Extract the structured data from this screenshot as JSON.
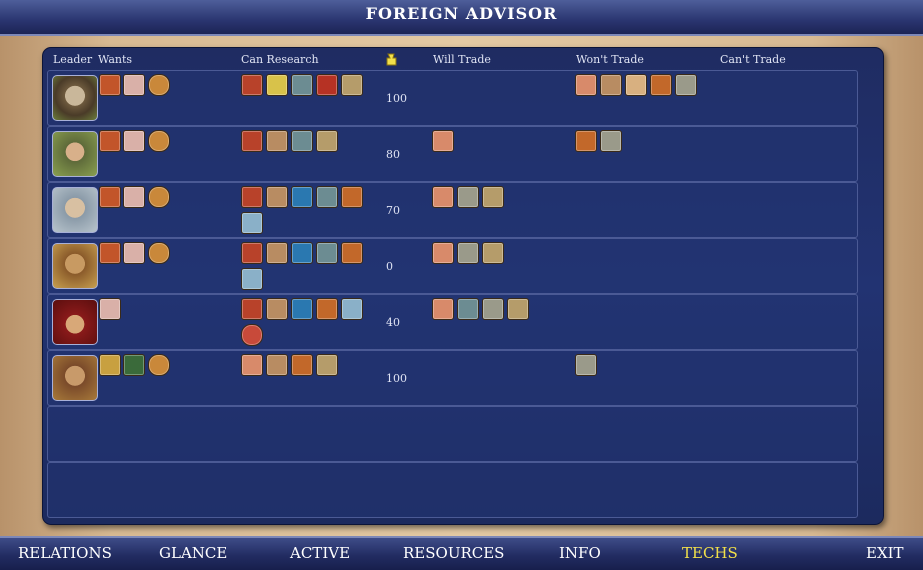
{
  "title": "FOREIGN ADVISOR",
  "headers": {
    "leader": "Leader",
    "wants": "Wants",
    "can_research": "Can Research",
    "will_trade": "Will Trade",
    "wont_trade": "Won't Trade",
    "cant_trade": "Can't Trade"
  },
  "rows": [
    {
      "attitude": "100"
    },
    {
      "attitude": "80"
    },
    {
      "attitude": "70"
    },
    {
      "attitude": "0"
    },
    {
      "attitude": "40"
    },
    {
      "attitude": "100"
    },
    {
      "attitude": ""
    },
    {
      "attitude": ""
    }
  ],
  "tabs": [
    "RELATIONS",
    "GLANCE",
    "ACTIVE",
    "RESOURCES",
    "INFO",
    "TECHS",
    "EXIT"
  ],
  "active_tab": "TECHS",
  "colors": {
    "accent": "#f2e04a",
    "panel": "#223372",
    "bar": "#2a3570"
  }
}
